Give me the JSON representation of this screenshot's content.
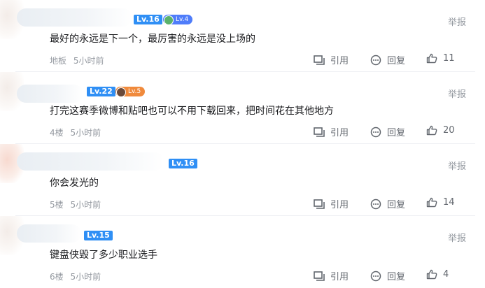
{
  "actions": {
    "quote": "引用",
    "reply": "回复",
    "report": "举报"
  },
  "comments": [
    {
      "level": "Lv.16",
      "sub_badge": "Lv.4",
      "text": "最好的永远是下一个，最厉害的永远是没上场的",
      "floor": "地板",
      "time": "5小时前",
      "likes": "11"
    },
    {
      "level": "Lv.22",
      "sub_badge": "Lv.5",
      "text": "打完这赛季微博和贴吧也可以不用下载回来，把时间花在其他地方",
      "floor": "4楼",
      "time": "5小时前",
      "likes": "20"
    },
    {
      "level": "Lv.16",
      "sub_badge": null,
      "text": "你会发光的",
      "floor": "5楼",
      "time": "5小时前",
      "likes": "14"
    },
    {
      "level": "Lv.15",
      "sub_badge": null,
      "text": "键盘侠毁了多少职业选手",
      "floor": "6楼",
      "time": "5小时前",
      "likes": "4"
    }
  ],
  "colors": {
    "level_badge": "#2f8ff5",
    "sub_badge_1": "#4f7dfa",
    "sub_badge_2": "#f08a3c"
  }
}
